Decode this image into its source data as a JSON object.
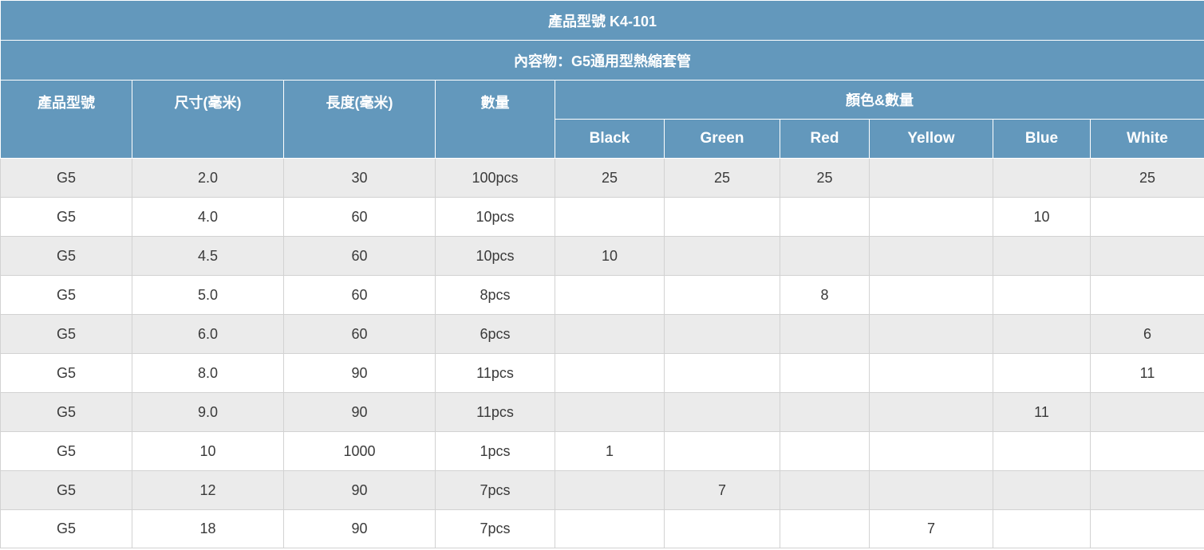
{
  "table": {
    "title": "產品型號 K4-101",
    "subtitle": "內容物：G5通用型熱縮套管",
    "headers": {
      "model": "產品型號",
      "size": "尺寸(毫米)",
      "length": "長度(毫米)",
      "quantity": "數量",
      "color_group": "顏色&數量",
      "colors": [
        "Black",
        "Green",
        "Red",
        "Yellow",
        "Blue",
        "White"
      ]
    },
    "rows": [
      {
        "model": "G5",
        "size": "2.0",
        "length": "30",
        "quantity": "100pcs",
        "colors": [
          "25",
          "25",
          "25",
          "",
          "",
          "25"
        ]
      },
      {
        "model": "G5",
        "size": "4.0",
        "length": "60",
        "quantity": "10pcs",
        "colors": [
          "",
          "",
          "",
          "",
          "10",
          ""
        ]
      },
      {
        "model": "G5",
        "size": "4.5",
        "length": "60",
        "quantity": "10pcs",
        "colors": [
          "10",
          "",
          "",
          "",
          "",
          ""
        ]
      },
      {
        "model": "G5",
        "size": "5.0",
        "length": "60",
        "quantity": "8pcs",
        "colors": [
          "",
          "",
          "8",
          "",
          "",
          ""
        ]
      },
      {
        "model": "G5",
        "size": "6.0",
        "length": "60",
        "quantity": "6pcs",
        "colors": [
          "",
          "",
          "",
          "",
          "",
          "6"
        ]
      },
      {
        "model": "G5",
        "size": "8.0",
        "length": "90",
        "quantity": "11pcs",
        "colors": [
          "",
          "",
          "",
          "",
          "",
          "11"
        ]
      },
      {
        "model": "G5",
        "size": "9.0",
        "length": "90",
        "quantity": "11pcs",
        "colors": [
          "",
          "",
          "",
          "",
          "11",
          ""
        ]
      },
      {
        "model": "G5",
        "size": "10",
        "length": "1000",
        "quantity": "1pcs",
        "colors": [
          "1",
          "",
          "",
          "",
          "",
          ""
        ]
      },
      {
        "model": "G5",
        "size": "12",
        "length": "90",
        "quantity": "7pcs",
        "colors": [
          "",
          "7",
          "",
          "",
          "",
          ""
        ]
      },
      {
        "model": "G5",
        "size": "18",
        "length": "90",
        "quantity": "7pcs",
        "colors": [
          "",
          "",
          "",
          "7",
          "",
          ""
        ]
      }
    ]
  }
}
